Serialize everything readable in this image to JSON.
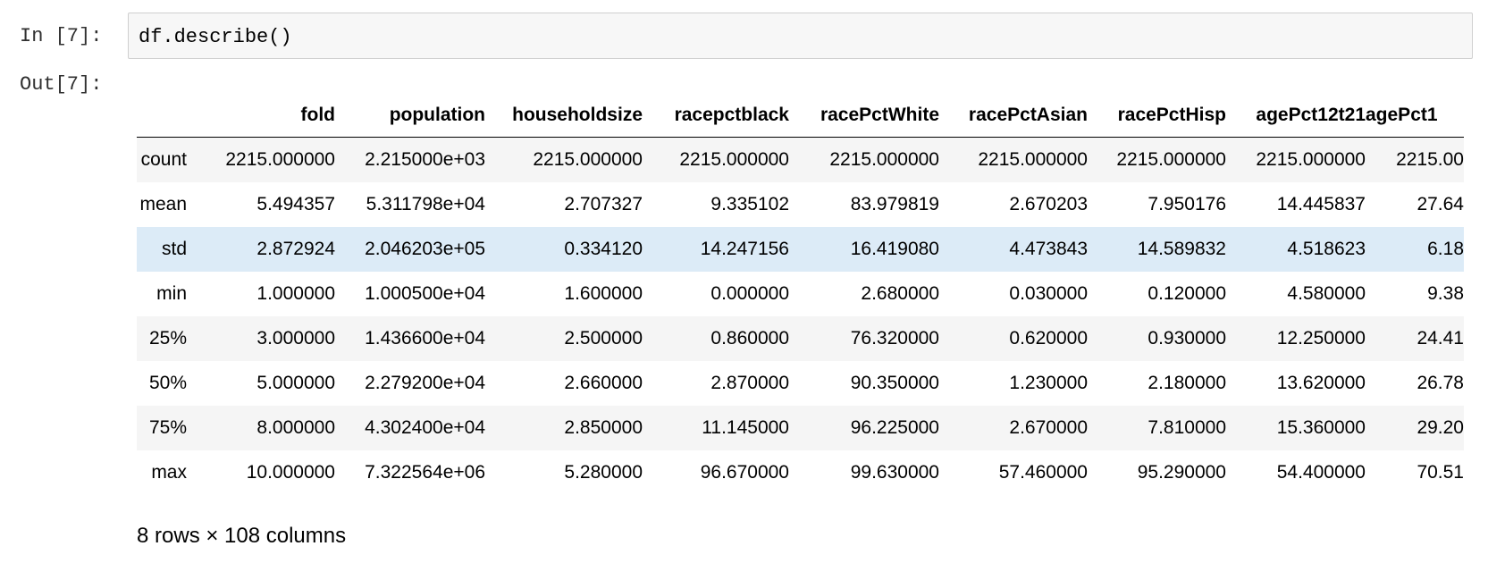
{
  "cell": {
    "in_prompt": "In [7]:",
    "code": "df.describe()",
    "out_prompt": "Out[7]:"
  },
  "table": {
    "columns": [
      "fold",
      "population",
      "householdsize",
      "racepctblack",
      "racePctWhite",
      "racePctAsian",
      "racePctHisp",
      "agePct12t21",
      "agePct1"
    ],
    "rows": [
      {
        "index": "count",
        "values": [
          "2215.000000",
          "2.215000e+03",
          "2215.000000",
          "2215.000000",
          "2215.000000",
          "2215.000000",
          "2215.000000",
          "2215.000000",
          "2215.00"
        ]
      },
      {
        "index": "mean",
        "values": [
          "5.494357",
          "5.311798e+04",
          "2.707327",
          "9.335102",
          "83.979819",
          "2.670203",
          "7.950176",
          "14.445837",
          "27.64"
        ]
      },
      {
        "index": "std",
        "values": [
          "2.872924",
          "2.046203e+05",
          "0.334120",
          "14.247156",
          "16.419080",
          "4.473843",
          "14.589832",
          "4.518623",
          "6.18"
        ]
      },
      {
        "index": "min",
        "values": [
          "1.000000",
          "1.000500e+04",
          "1.600000",
          "0.000000",
          "2.680000",
          "0.030000",
          "0.120000",
          "4.580000",
          "9.38"
        ]
      },
      {
        "index": "25%",
        "values": [
          "3.000000",
          "1.436600e+04",
          "2.500000",
          "0.860000",
          "76.320000",
          "0.620000",
          "0.930000",
          "12.250000",
          "24.41"
        ]
      },
      {
        "index": "50%",
        "values": [
          "5.000000",
          "2.279200e+04",
          "2.660000",
          "2.870000",
          "90.350000",
          "1.230000",
          "2.180000",
          "13.620000",
          "26.78"
        ]
      },
      {
        "index": "75%",
        "values": [
          "8.000000",
          "4.302400e+04",
          "2.850000",
          "11.145000",
          "96.225000",
          "2.670000",
          "7.810000",
          "15.360000",
          "29.20"
        ]
      },
      {
        "index": "max",
        "values": [
          "10.000000",
          "7.322564e+06",
          "5.280000",
          "96.670000",
          "99.630000",
          "57.460000",
          "95.290000",
          "54.400000",
          "70.51"
        ]
      }
    ],
    "hovered_row": "std"
  },
  "footer": {
    "shape_note": "8 rows × 108 columns"
  }
}
